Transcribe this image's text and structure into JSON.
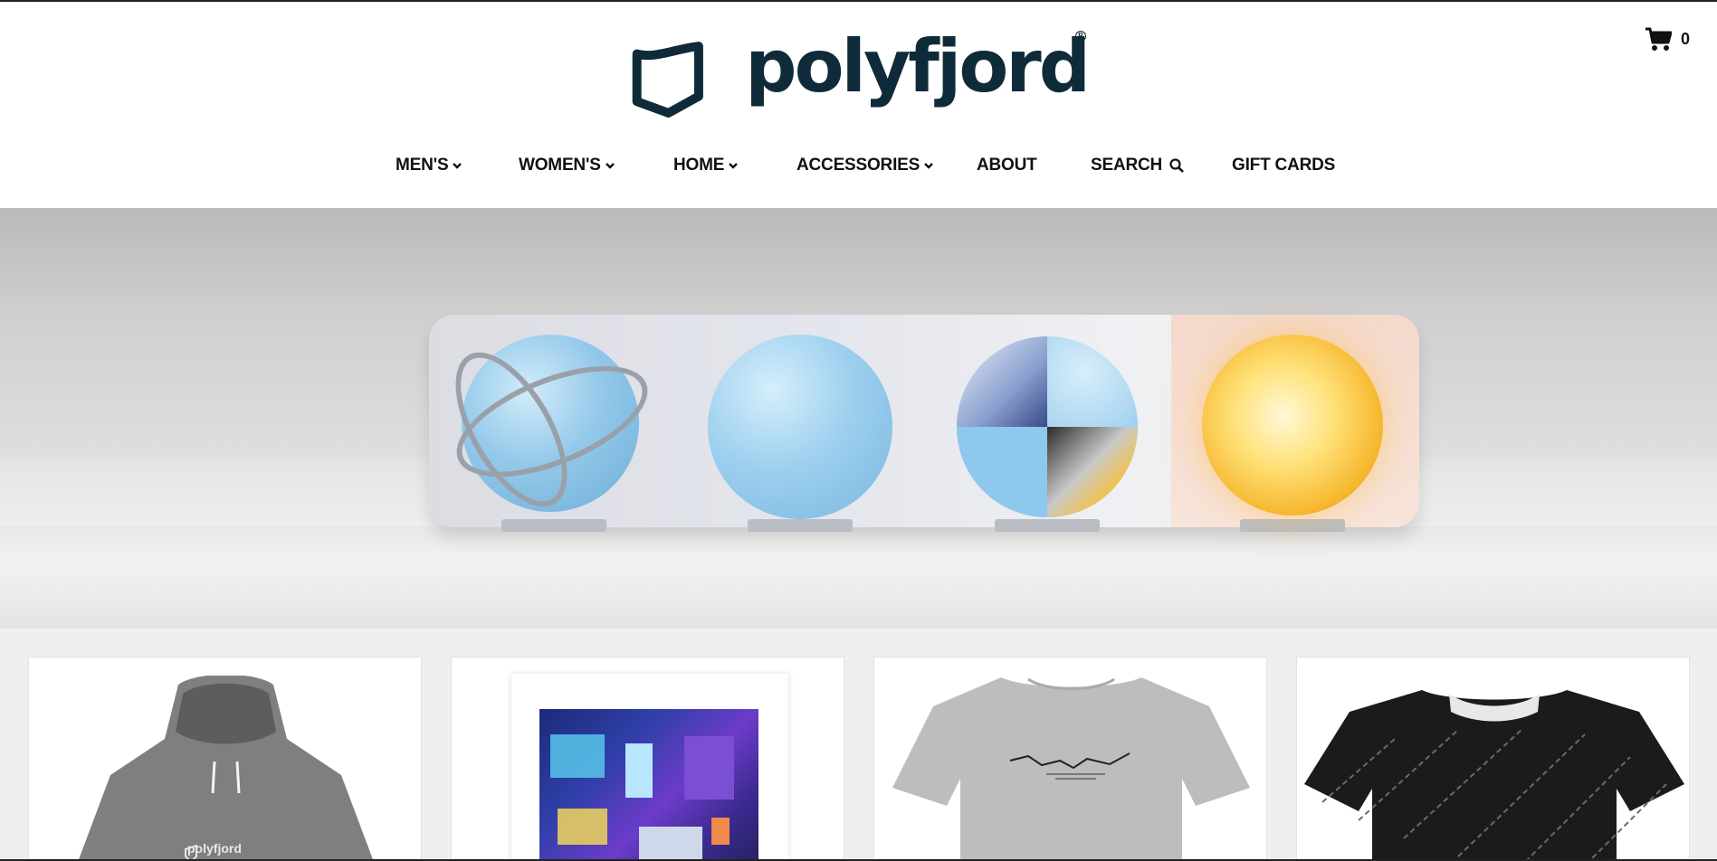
{
  "brand": {
    "name": "polyfjord",
    "registered_mark": "R"
  },
  "cart": {
    "count": "0"
  },
  "nav": {
    "mens": "MEN'S",
    "womens": "WOMEN'S",
    "home": "HOME",
    "accessories": "ACCESSORIES",
    "about": "ABOUT",
    "search": "SEARCH",
    "gift_cards": "GIFT CARDS"
  },
  "products": [
    {
      "type": "hoodie",
      "print_text": "polyfjord"
    },
    {
      "type": "art-print"
    },
    {
      "type": "t-shirt"
    },
    {
      "type": "t-shirt-allover"
    }
  ],
  "colors": {
    "brand": "#0f2b3a",
    "page_background": "#efefef",
    "hero_background": "#d6d6d6"
  }
}
